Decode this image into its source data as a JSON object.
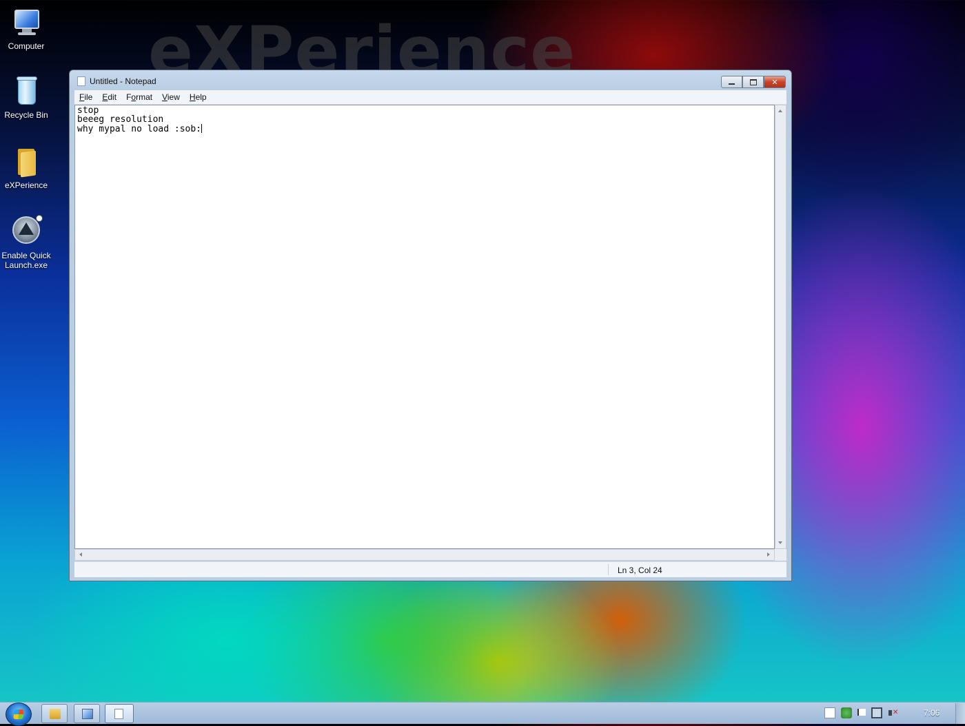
{
  "wallpaper": {
    "watermark": "eXPerience"
  },
  "desktop": {
    "icons": [
      {
        "label": "Computer",
        "icon": "computer-icon"
      },
      {
        "label": "Recycle Bin",
        "icon": "recycle-bin-icon"
      },
      {
        "label": "eXPerience",
        "icon": "folder-icon"
      },
      {
        "label_line1": "Enable Quick",
        "label_line2": "Launch.exe",
        "icon": "quick-launch-icon"
      }
    ]
  },
  "window": {
    "title": "Untitled - Notepad",
    "caption_buttons": [
      "minimize",
      "maximize",
      "close"
    ],
    "close_glyph": "✕",
    "menu": [
      {
        "accel": "F",
        "rest": "ile"
      },
      {
        "accel": "E",
        "rest": "dit"
      },
      {
        "pre": "F",
        "accel": "o",
        "rest": "rmat"
      },
      {
        "accel": "V",
        "rest": "iew"
      },
      {
        "accel": "H",
        "rest": "elp"
      }
    ],
    "text_lines": [
      "stop",
      "beeeg resolution",
      "why mypal no load :sob:"
    ],
    "status": {
      "position": "Ln 3, Col 24"
    }
  },
  "taskbar": {
    "buttons": [
      "start-button",
      "explorer-button",
      "remote-desktop-button",
      "notepad-button"
    ],
    "clock": "7:06"
  },
  "colors": {
    "titlebar": "#c7d9ec",
    "close_button": "#c7442a",
    "taskbar": "#b9cde4"
  }
}
